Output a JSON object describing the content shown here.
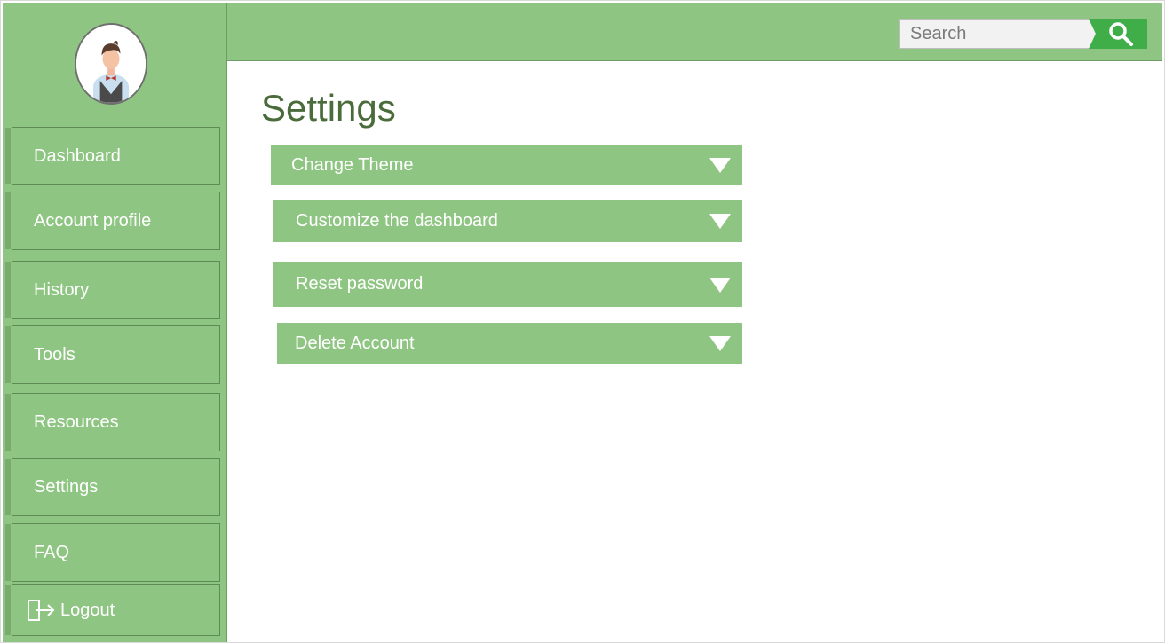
{
  "sidebar": {
    "items": [
      {
        "label": "Dashboard"
      },
      {
        "label": "Account profile"
      },
      {
        "label": "History"
      },
      {
        "label": "Tools"
      },
      {
        "label": "Resources"
      },
      {
        "label": "Settings"
      },
      {
        "label": "FAQ"
      }
    ],
    "logout_label": "Logout"
  },
  "header": {
    "search": {
      "placeholder": "Search",
      "value": ""
    }
  },
  "main": {
    "title": "Settings",
    "sections": [
      {
        "label": "Change Theme",
        "icon": "chevron-down-icon"
      },
      {
        "label": "Customize the dashboard",
        "icon": "chevron-down-icon"
      },
      {
        "label": "Reset password",
        "icon": "chevron-down-icon"
      },
      {
        "label": "Delete Account",
        "icon": "chevron-down-icon"
      }
    ]
  },
  "colors": {
    "primary": "#8fc582",
    "search_button": "#3fae49",
    "title": "#4a6b3a",
    "text_on_primary": "#ffffff"
  }
}
